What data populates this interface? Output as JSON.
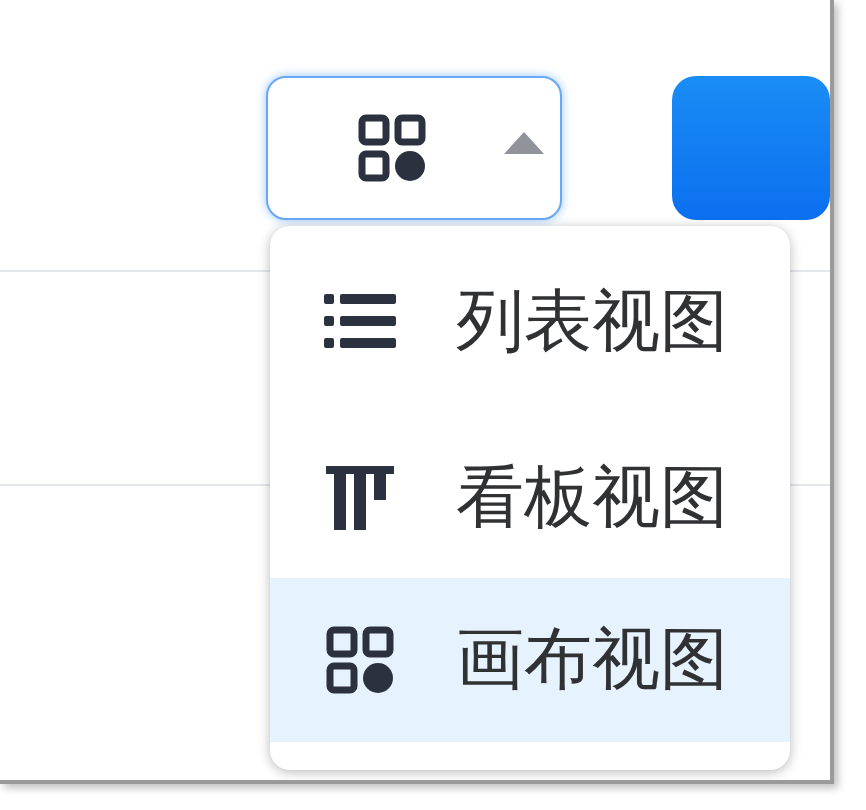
{
  "view_switcher": {
    "expanded": true
  },
  "menu": {
    "items": [
      {
        "kind": "list",
        "label": "列表视图",
        "selected": false
      },
      {
        "kind": "kanban",
        "label": "看板视图",
        "selected": false
      },
      {
        "kind": "canvas",
        "label": "画布视图",
        "selected": true
      }
    ]
  }
}
